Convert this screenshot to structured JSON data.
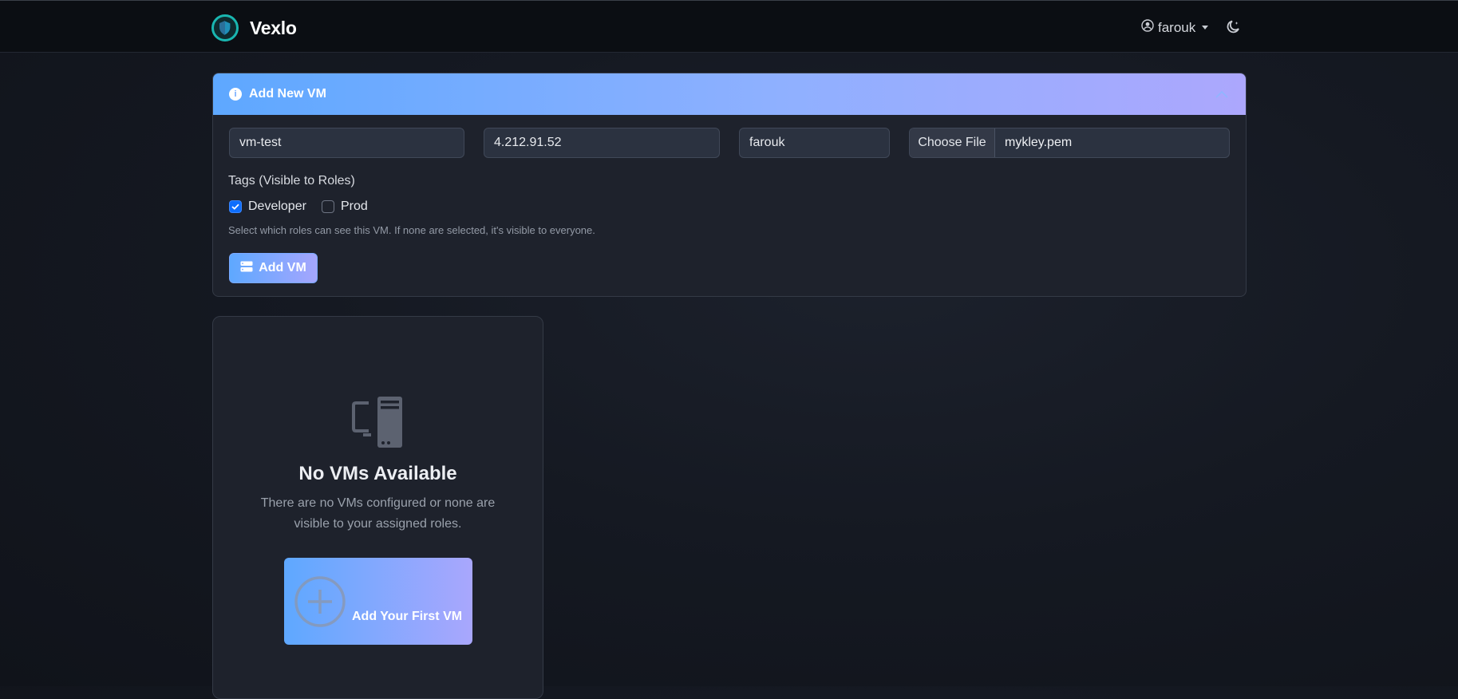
{
  "app": {
    "name": "Vexlo",
    "logo_icon": "shield-icon",
    "accent": "#19b6b0"
  },
  "navbar": {
    "user": {
      "name": "farouk",
      "icon": "user-circle-icon"
    },
    "theme_toggle_icon": "moon-stars-icon"
  },
  "add_vm": {
    "title": "Add New VM",
    "header_icon": "info-icon",
    "collapse_icon": "chevron-up-icon",
    "fields": {
      "name": "vm-test",
      "host": "4.212.91.52",
      "username": "farouk",
      "file_button": "Choose File",
      "file_name": "mykley.pem"
    },
    "tags": {
      "label": "Tags (Visible to Roles)",
      "options": [
        {
          "label": "Developer",
          "checked": true
        },
        {
          "label": "Prod",
          "checked": false
        }
      ],
      "help": "Select which roles can see this VM. If none are selected, it's visible to everyone."
    },
    "submit": {
      "label": "Add VM",
      "icon": "server-icon"
    }
  },
  "empty_state": {
    "icon": "pc-display-icon",
    "title": "No VMs Available",
    "description": "There are no VMs configured or none are visible to your assigned roles.",
    "button": {
      "label": "Add Your First VM",
      "icon": "plus-circle-icon"
    }
  },
  "colors": {
    "gradient_start": "#5ea8ff",
    "gradient_end": "#aca7fd",
    "checkbox_checked": "#0d6efd"
  }
}
